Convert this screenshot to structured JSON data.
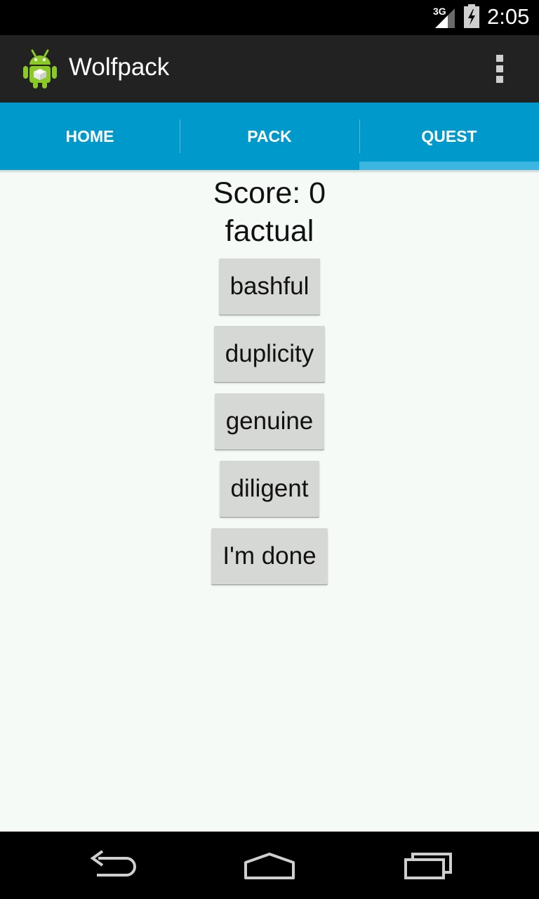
{
  "status_bar": {
    "network": "3G",
    "time": "2:05"
  },
  "action_bar": {
    "title": "Wolfpack",
    "icons": {
      "app": "android-icon",
      "overflow": "more-vert-icon"
    }
  },
  "tabs": [
    {
      "label": "HOME",
      "selected": false
    },
    {
      "label": "PACK",
      "selected": false
    },
    {
      "label": "QUEST",
      "selected": true
    }
  ],
  "quest": {
    "score_text": "Score: 0",
    "word": "factual",
    "options": [
      "bashful",
      "duplicity",
      "genuine",
      "diligent"
    ],
    "done_label": "I'm done"
  },
  "navigation": {
    "icons": [
      "back-icon",
      "home-icon",
      "recent-apps-icon"
    ]
  },
  "colors": {
    "tab_bar": "#0099cc",
    "action_bar": "#222222",
    "background": "#f5faf7",
    "button": "#d6d8d5"
  }
}
